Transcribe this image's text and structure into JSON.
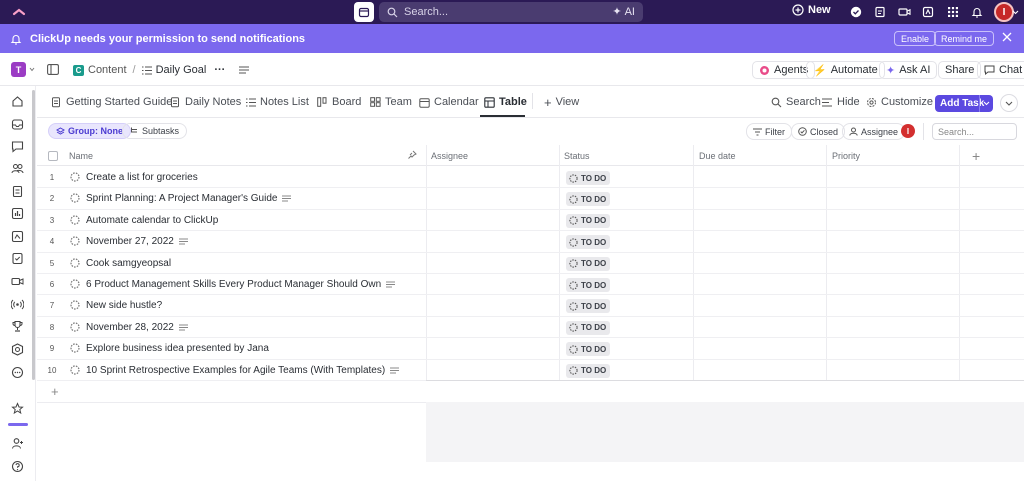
{
  "topbar": {
    "search_placeholder": "Search...",
    "ai_label": "AI",
    "new_label": "New",
    "avatar_initial": "I"
  },
  "notification": {
    "message": "ClickUp needs your permission to send notifications",
    "enable_label": "Enable",
    "remind_label": "Remind me"
  },
  "breadcrumb": {
    "workspace_initial": "T",
    "space_initial": "C",
    "space_label": "Content",
    "separator": "/",
    "list_label": "Daily Goal",
    "more": "···"
  },
  "header_actions": {
    "agents": "Agents",
    "automate": "Automate",
    "ask_ai": "Ask AI",
    "share": "Share",
    "chat": "Chat"
  },
  "tabs": [
    {
      "label": "Getting Started Guide",
      "icon": "doc-icon"
    },
    {
      "label": "Daily Notes",
      "icon": "doc-icon"
    },
    {
      "label": "Notes List",
      "icon": "list-icon"
    },
    {
      "label": "Board",
      "icon": "board-icon"
    },
    {
      "label": "Team",
      "icon": "team-icon"
    },
    {
      "label": "Calendar",
      "icon": "calendar-icon"
    },
    {
      "label": "Table",
      "icon": "table-icon",
      "active": true
    },
    {
      "label": "View",
      "icon": "plus-icon"
    }
  ],
  "toolbar": {
    "search": "Search",
    "hide": "Hide",
    "customize": "Customize",
    "add_task": "Add Task"
  },
  "filters": {
    "group": "Group: None",
    "subtasks": "Subtasks",
    "filter": "Filter",
    "closed": "Closed",
    "assignee": "Assignee",
    "avatar_initial": "I",
    "search_placeholder": "Search..."
  },
  "table": {
    "columns": [
      "Name",
      "Assignee",
      "Status",
      "Due date",
      "Priority"
    ],
    "add_column": "+",
    "add_row": "+",
    "rows": [
      {
        "num": "1",
        "name": "Create a list for groceries",
        "has_desc": false,
        "status": "TO DO"
      },
      {
        "num": "2",
        "name": "Sprint Planning: A Project Manager's Guide",
        "has_desc": true,
        "status": "TO DO"
      },
      {
        "num": "3",
        "name": "Automate calendar to ClickUp",
        "has_desc": false,
        "status": "TO DO"
      },
      {
        "num": "4",
        "name": "November 27, 2022",
        "has_desc": true,
        "status": "TO DO"
      },
      {
        "num": "5",
        "name": "Cook samgyeopsal",
        "has_desc": false,
        "status": "TO DO"
      },
      {
        "num": "6",
        "name": "6 Product Management Skills Every Product Manager Should Own",
        "has_desc": true,
        "status": "TO DO"
      },
      {
        "num": "7",
        "name": "New side hustle?",
        "has_desc": false,
        "status": "TO DO"
      },
      {
        "num": "8",
        "name": "November 28, 2022",
        "has_desc": true,
        "status": "TO DO"
      },
      {
        "num": "9",
        "name": "Explore business idea presented by Jana",
        "has_desc": false,
        "status": "TO DO"
      },
      {
        "num": "10",
        "name": "10 Sprint Retrospective Examples for Agile Teams (With Templates)",
        "has_desc": true,
        "status": "TO DO"
      }
    ]
  },
  "colors": {
    "topbar_bg": "#2b1a55",
    "notification_bg": "#7b68ee",
    "accent": "#5b49e0",
    "status_bg": "#e9e9ec",
    "avatar": "#d32f2f"
  }
}
